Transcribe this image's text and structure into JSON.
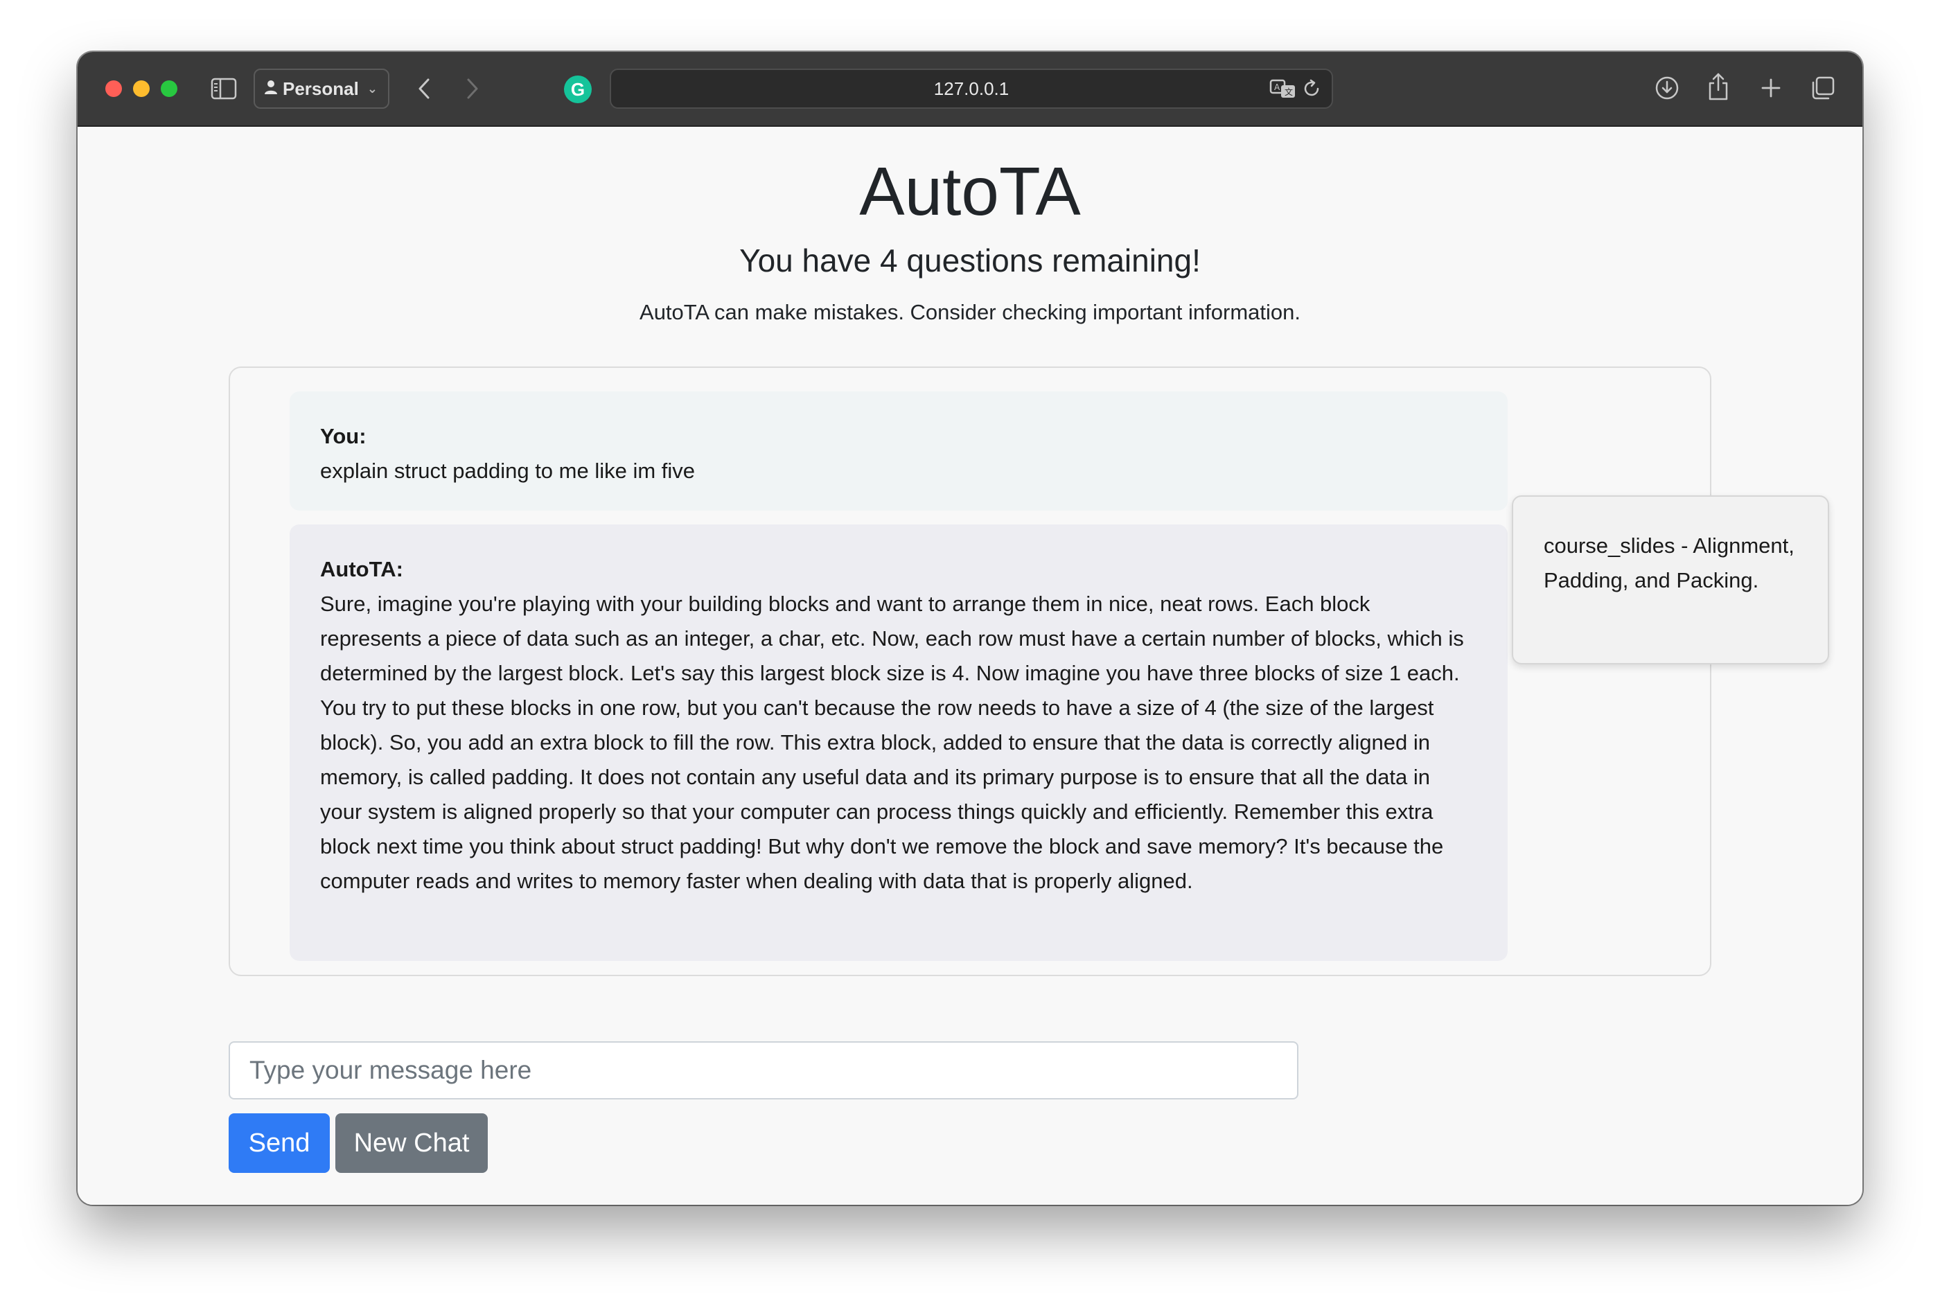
{
  "browser": {
    "profile_label": "Personal",
    "url": "127.0.0.1",
    "extension_icon": "grammarly-icon",
    "colors": {
      "close": "#ff5f57",
      "minimize": "#febc2e",
      "zoom": "#28c840"
    }
  },
  "page": {
    "title": "AutoTA",
    "remaining": "You have 4 questions remaining!",
    "disclaimer": "AutoTA can make mistakes. Consider checking important information."
  },
  "chat": {
    "messages": [
      {
        "author": "You:",
        "text": "explain struct padding to me like im five"
      },
      {
        "author": "AutoTA:",
        "text": "Sure, imagine you're playing with your building blocks and want to arrange them in nice, neat rows. Each block represents a piece of data such as an integer, a char, etc. Now, each row must have a certain number of blocks, which is determined by the largest block. Let's say this largest block size is 4. Now imagine you have three blocks of size 1 each. You try to put these blocks in one row, but you can't because the row needs to have a size of 4 (the size of the largest block). So, you add an extra block to fill the row. This extra block, added to ensure that the data is correctly aligned in memory, is called padding. It does not contain any useful data and its primary purpose is to ensure that all the data in your system is aligned properly so that your computer can process things quickly and efficiently. Remember this extra block next time you think about struct padding! But why don't we remove the block and save memory? It's because the computer reads and writes to memory faster when dealing with data that is properly aligned."
      }
    ],
    "source": "course_slides - Alignment, Padding, and Packing."
  },
  "composer": {
    "placeholder": "Type your message here",
    "value": "",
    "send_label": "Send",
    "new_chat_label": "New Chat",
    "colors": {
      "send": "#2f7bf5",
      "new_chat": "#6c757d"
    }
  }
}
